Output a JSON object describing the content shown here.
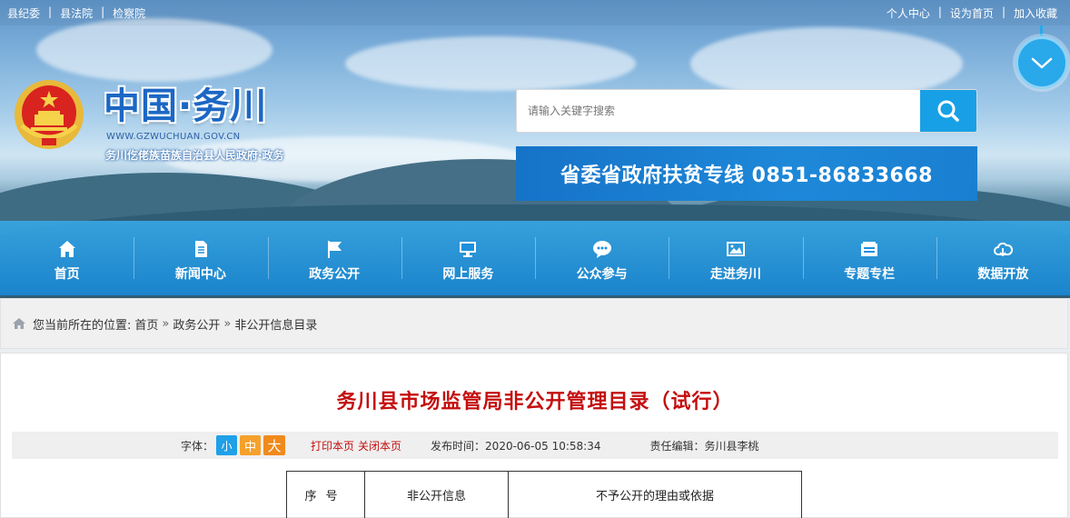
{
  "topbar": {
    "left_links": [
      "县纪委",
      "县法院",
      "检察院"
    ],
    "right_links": [
      "个人中心",
      "设为首页",
      "加入收藏"
    ]
  },
  "logo": {
    "title": "中国·务川",
    "url_text": "WWW.GZWUCHUAN.GOV.CN",
    "subtitle": "务川仡佬族苗族自治县人民政府·政务"
  },
  "search": {
    "placeholder": "请输入关键字搜索"
  },
  "hotline": {
    "text": "省委省政府扶贫专线 0851-86833668"
  },
  "nav": {
    "items": [
      {
        "label": "首页",
        "icon": "home-icon"
      },
      {
        "label": "新闻中心",
        "icon": "document-icon"
      },
      {
        "label": "政务公开",
        "icon": "flag-icon"
      },
      {
        "label": "网上服务",
        "icon": "monitor-icon"
      },
      {
        "label": "公众参与",
        "icon": "chat-icon"
      },
      {
        "label": "走进务川",
        "icon": "picture-icon"
      },
      {
        "label": "专题专栏",
        "icon": "folder-icon"
      },
      {
        "label": "数据开放",
        "icon": "cloud-icon"
      }
    ]
  },
  "breadcrumb": {
    "prefix": "您当前所在的位置:",
    "items": [
      "首页",
      "政务公开",
      "非公开信息目录"
    ],
    "separator": "»"
  },
  "article": {
    "title": "务川县市场监管局非公开管理目录（试行）",
    "font_label": "字体：",
    "font_small": "小",
    "font_medium": "中",
    "font_large": "大",
    "print_label": "打印本页",
    "close_label": "关闭本页",
    "publish_time": "发布时间：2020-06-05 10:58:34",
    "editor": "责任编辑：务川县李桃"
  },
  "table": {
    "headers": [
      "序号",
      "非公开信息",
      "不予公开的理由或依据"
    ]
  },
  "colors": {
    "nav_blue": "#1e90dc",
    "title_red": "#c40f0f",
    "search_blue": "#18a0e6"
  }
}
